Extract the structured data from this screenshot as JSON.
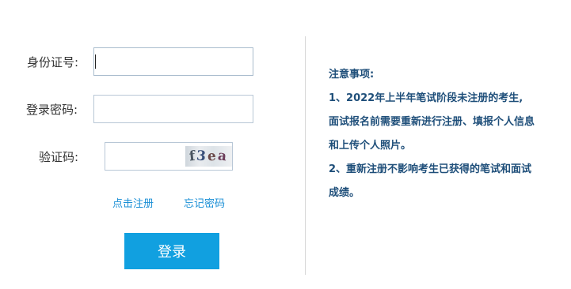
{
  "form": {
    "id_label": "身份证号:",
    "id_value": "",
    "password_label": "登录密码:",
    "password_value": "",
    "captcha_label": "验证码:",
    "captcha_value": "",
    "captcha_text": [
      "f",
      "3",
      "e",
      "a"
    ],
    "register_link": "点击注册",
    "forgot_link": "忘记密码",
    "login_button": "登录"
  },
  "notice": {
    "title": "注意事项:",
    "lines": [
      "1、2022年上半年笔试阶段未注册的考生,",
      "面试报名前需要重新进行注册、填报个人信息",
      "和上传个人照片。",
      "2、重新注册不影响考生已获得的笔试和面试",
      "成绩。"
    ]
  },
  "colors": {
    "accent": "#11a0e0",
    "link": "#1a8fd6",
    "notice_text": "#1f4f7a"
  }
}
